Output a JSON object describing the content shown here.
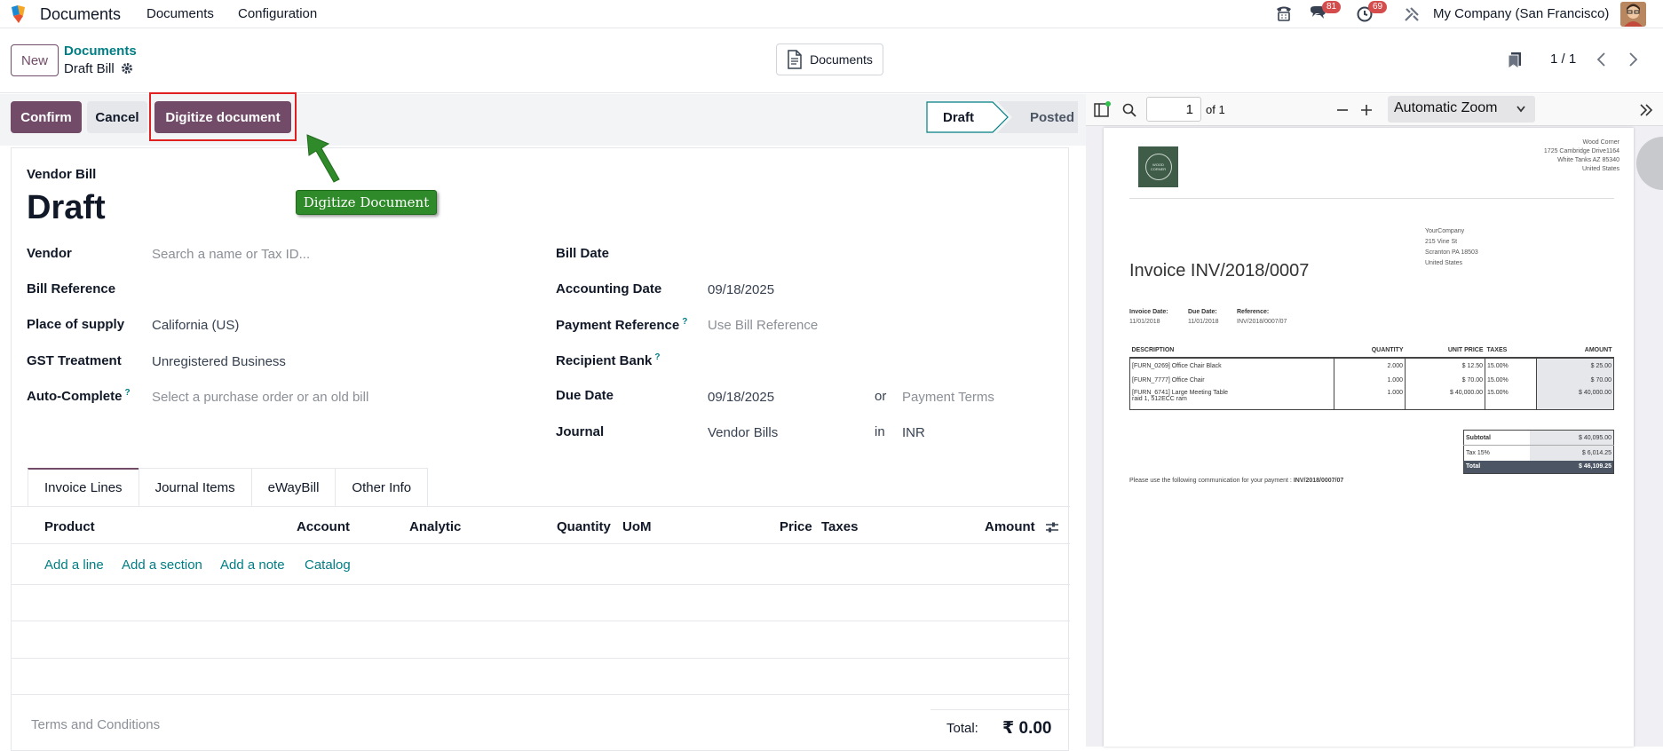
{
  "topbar": {
    "app_name": "Documents",
    "menu": [
      "Documents",
      "Configuration"
    ],
    "messages_count": "81",
    "activities_count": "69",
    "company": "My Company (San Francisco)"
  },
  "control_panel": {
    "new_label": "New",
    "breadcrumb_parent": "Documents",
    "breadcrumb_current": "Draft Bill",
    "documents_button": "Documents",
    "pager": "1 / 1"
  },
  "status_bar": {
    "confirm": "Confirm",
    "cancel": "Cancel",
    "digitize": "Digitize document",
    "stages": [
      "Draft",
      "Posted"
    ],
    "active_stage": "Draft"
  },
  "callout": "Digitize Document",
  "form": {
    "type_label": "Vendor Bill",
    "title": "Draft",
    "left": {
      "vendor_label": "Vendor",
      "vendor_placeholder": "Search a name or Tax ID...",
      "bill_reference_label": "Bill Reference",
      "place_of_supply_label": "Place of supply",
      "place_of_supply_value": "California (US)",
      "gst_treatment_label": "GST Treatment",
      "gst_treatment_value": "Unregistered Business",
      "auto_complete_label": "Auto-Complete",
      "auto_complete_placeholder": "Select a purchase order or an old bill"
    },
    "right": {
      "bill_date_label": "Bill Date",
      "accounting_date_label": "Accounting Date",
      "accounting_date_value": "09/18/2025",
      "payment_reference_label": "Payment Reference",
      "payment_reference_placeholder": "Use Bill Reference",
      "recipient_bank_label": "Recipient Bank",
      "due_date_label": "Due Date",
      "due_date_value": "09/18/2025",
      "or_label": "or",
      "payment_terms_placeholder": "Payment Terms",
      "journal_label": "Journal",
      "journal_value": "Vendor Bills",
      "in_label": "in",
      "currency_value": "INR"
    },
    "tabs": [
      "Invoice Lines",
      "Journal Items",
      "eWayBill",
      "Other Info"
    ],
    "columns": [
      "Product",
      "Account",
      "Analytic",
      "Quantity",
      "UoM",
      "Price",
      "Taxes",
      "Amount"
    ],
    "add_links": [
      "Add a line",
      "Add a section",
      "Add a note",
      "Catalog"
    ],
    "terms_placeholder": "Terms and Conditions",
    "total_label": "Total:",
    "total_value": "₹ 0.00"
  },
  "pdf_viewer": {
    "page_number": "1",
    "page_count": "of 1",
    "zoom": "Automatic Zoom",
    "document": {
      "logo_text": "WOOD CORNER",
      "company_address": [
        "Wood Corner",
        "1725 Cambridge Drive1164",
        "White Tanks AZ 85340",
        "United States"
      ],
      "customer_address": [
        "YourCompany",
        "215 Vine St",
        "Scranton PA 18503",
        "United States"
      ],
      "title": "Invoice INV/2018/0007",
      "meta": [
        {
          "label": "Invoice Date:",
          "value": "11/01/2018"
        },
        {
          "label": "Due Date:",
          "value": "11/01/2018"
        },
        {
          "label": "Reference:",
          "value": "INV/2018/0007/07"
        }
      ],
      "table_headers": [
        "DESCRIPTION",
        "QUANTITY",
        "UNIT PRICE",
        "TAXES",
        "AMOUNT"
      ],
      "lines": [
        {
          "desc": "[FURN_0269] Office Chair Black",
          "qty": "2.000",
          "price": "$ 12.50",
          "tax": "15.00%",
          "amount": "$ 25.00"
        },
        {
          "desc": "[FURN_7777] Office Chair",
          "qty": "1.000",
          "price": "$ 70.00",
          "tax": "15.00%",
          "amount": "$ 70.00"
        },
        {
          "desc": "[FURN_6741] Large Meeting Table",
          "desc2": "raid 1, 512ECC ram",
          "qty": "1.000",
          "price": "$ 40,000.00",
          "tax": "15.00%",
          "amount": "$ 40,000.00"
        }
      ],
      "subtotal_label": "Subtotal",
      "subtotal_value": "$ 40,095.00",
      "tax_label": "Tax 15%",
      "tax_value": "$ 6,014.25",
      "total_label": "Total",
      "total_value": "$ 46,109.25",
      "communication_prefix": "Please use the following communication for your payment :",
      "communication_ref": "INV/2018/0007/07"
    }
  },
  "colors": {
    "primary": "#714b67",
    "link": "#017e84",
    "callout": "#2f8a2a",
    "badge": "#d44c4c"
  }
}
